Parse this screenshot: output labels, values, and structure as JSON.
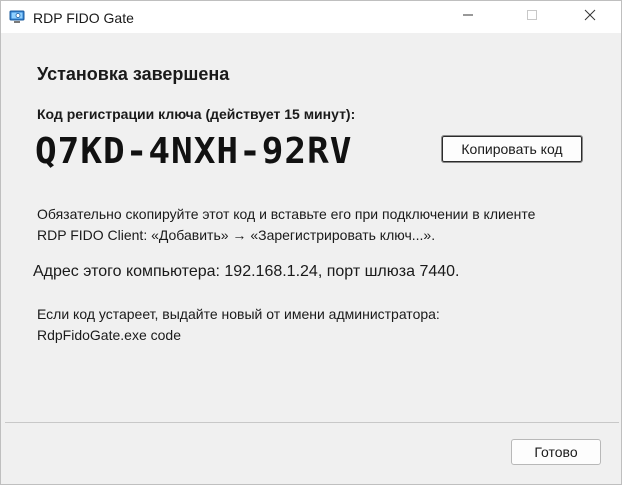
{
  "window": {
    "title": "RDP FIDO Gate",
    "icons": {
      "app": "monitor-icon",
      "minimize": "minimize-icon",
      "maximize": "maximize-icon",
      "close": "close-icon"
    }
  },
  "main": {
    "heading": "Установка завершена",
    "code_label": "Код регистрации ключа (действует 15 минут):",
    "code_value": "Q7KD-4NXH-92RV",
    "copy_button": "Копировать код",
    "instruction": [
      "Обязательно скопируйте этот код и вставьте его при подключении в клиенте",
      "RDP FIDO Client: «Добавить» → «Зарегистрировать ключ...»."
    ],
    "address": "Адрес этого компьютера: 192.168.1.24, порт шлюза 7440.",
    "admin_note": [
      "Если код устареет, выдайте новый от имени администратора:",
      "RdpFidoGate.exe code"
    ]
  },
  "footer": {
    "done_button": "Готово"
  },
  "colors": {
    "window_bg": "#f0f0f0",
    "titlebar_bg": "#ffffff",
    "text": "#1a1a1a"
  }
}
